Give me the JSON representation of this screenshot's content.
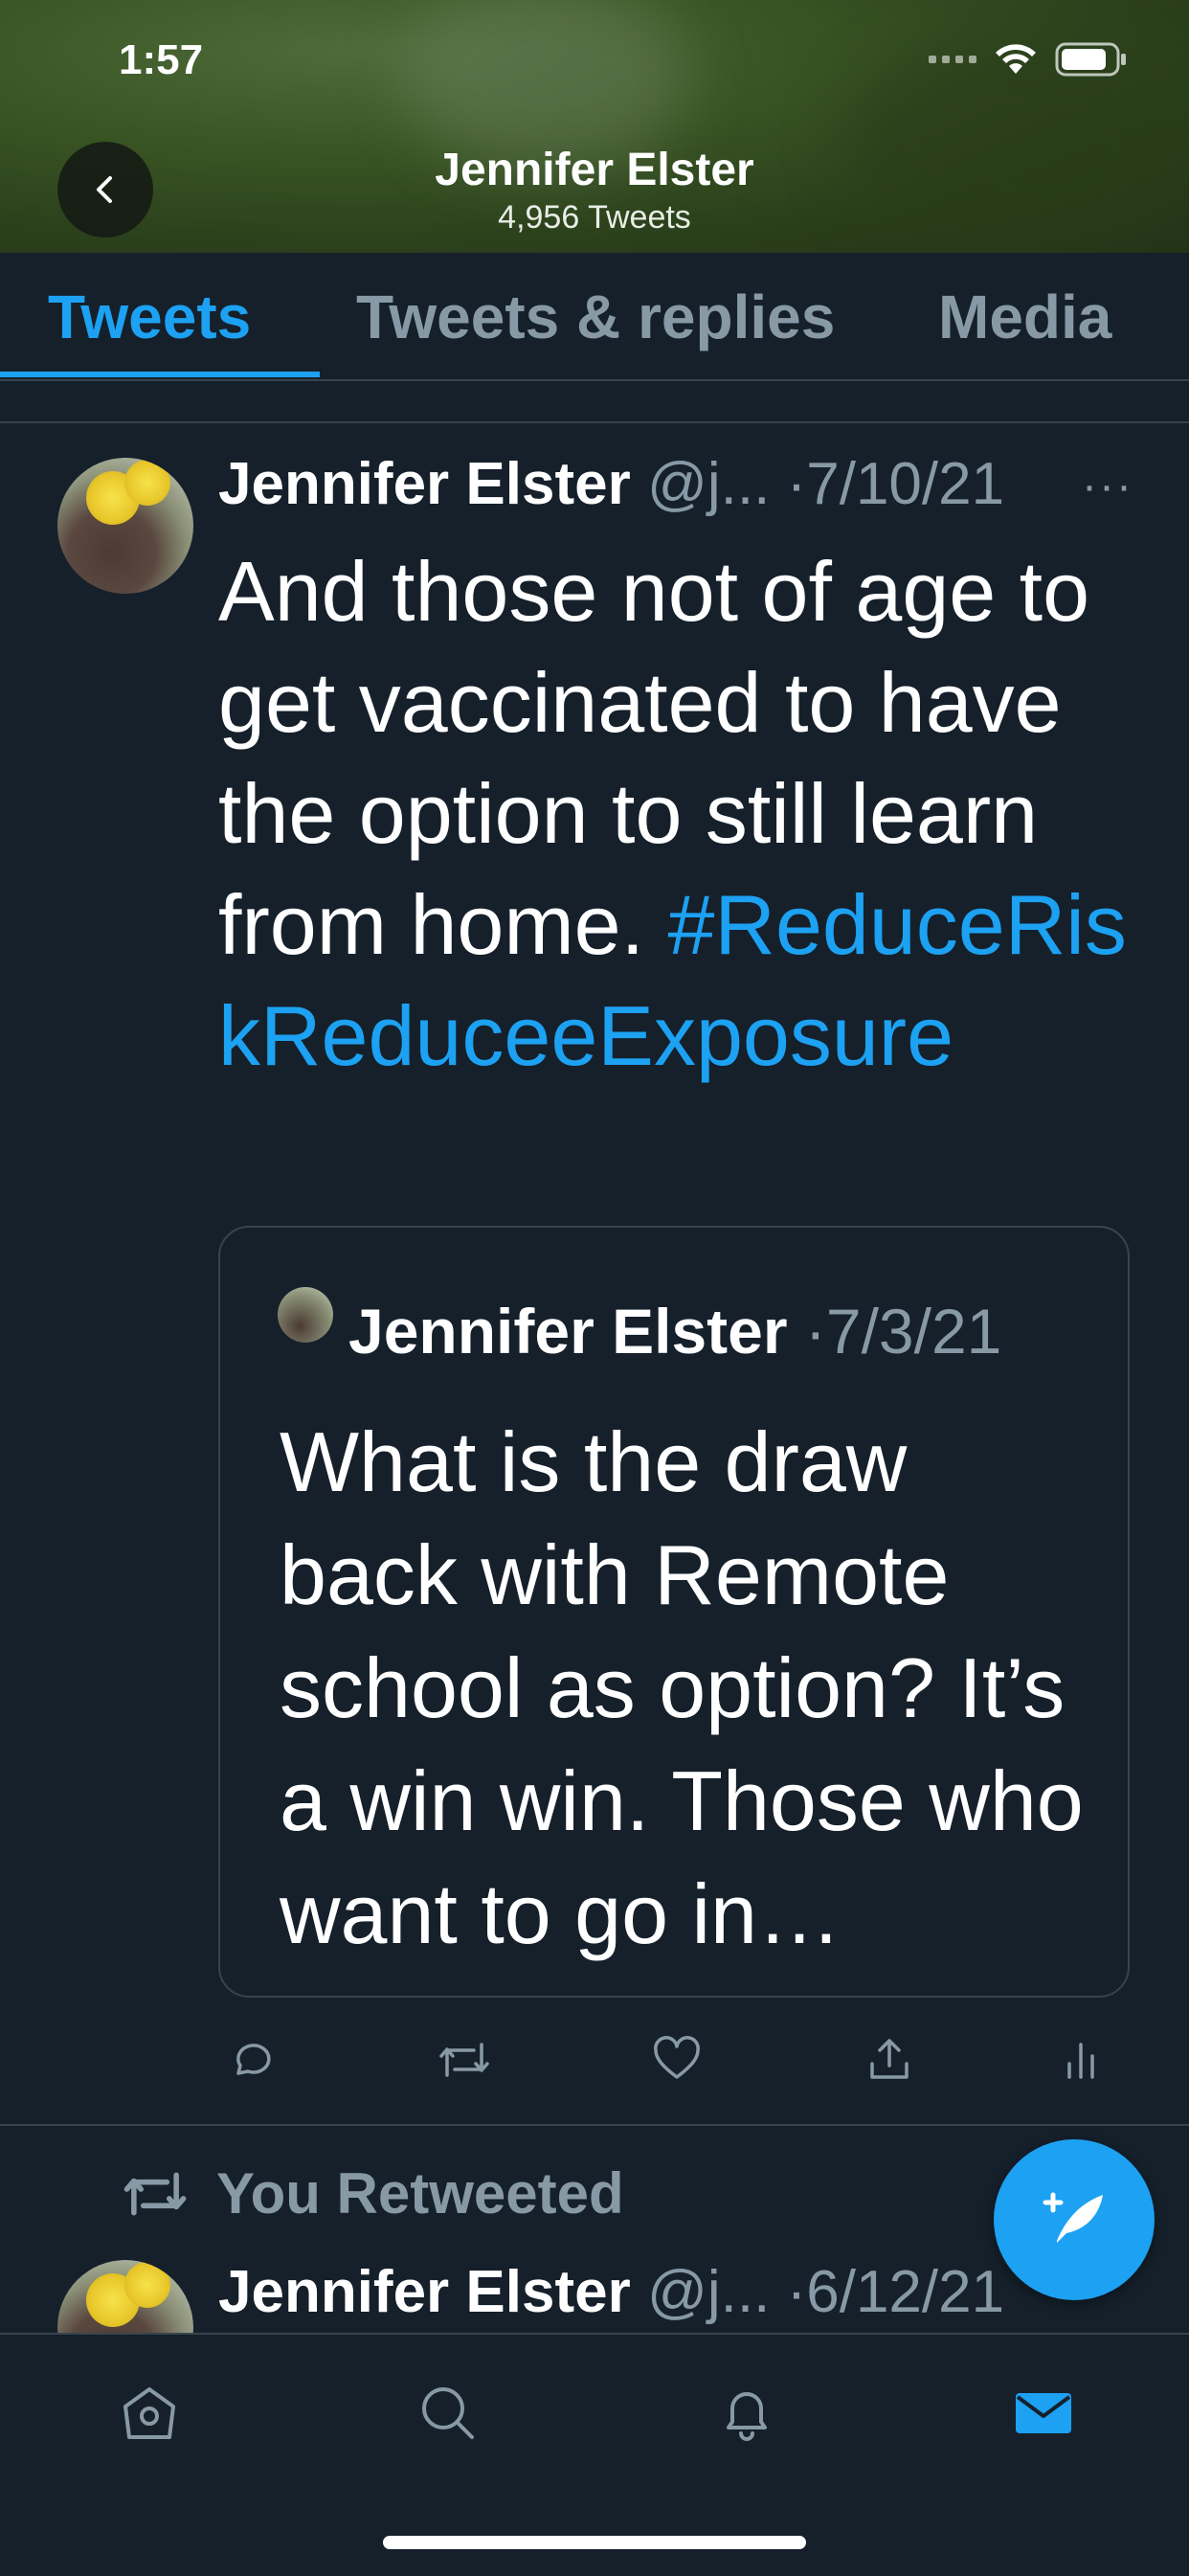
{
  "status_bar": {
    "time": "1:57"
  },
  "header": {
    "title": "Jennifer Elster",
    "subtitle": "4,956 Tweets"
  },
  "tabs": [
    {
      "label": "Tweets",
      "active": true
    },
    {
      "label": "Tweets & replies",
      "active": false
    },
    {
      "label": "Media",
      "active": false
    }
  ],
  "tweet": {
    "name": "Jennifer Elster",
    "handle": "@j...",
    "date_sep": " ·",
    "date": "7/10/21",
    "more": "···",
    "text": "And those not of age to get vaccinated to have the option to still learn from home.",
    "hashtag": "#ReduceRiskReduceeExposure",
    "quote": {
      "name": "Jennifer Elster",
      "date_sep": " ·",
      "date": "7/3/21",
      "text": "What is the draw back with Remote school as option? It’s a win win. Those who want to go in…"
    }
  },
  "retweet_label": "You Retweeted",
  "tweet2": {
    "name": "Jennifer Elster",
    "handle": "@j...",
    "date_sep": " ·",
    "date": "6/12/21"
  },
  "colors": {
    "background": "#15202b",
    "accent": "#1da1f2",
    "muted": "#8899a6",
    "divider": "#38444d"
  }
}
